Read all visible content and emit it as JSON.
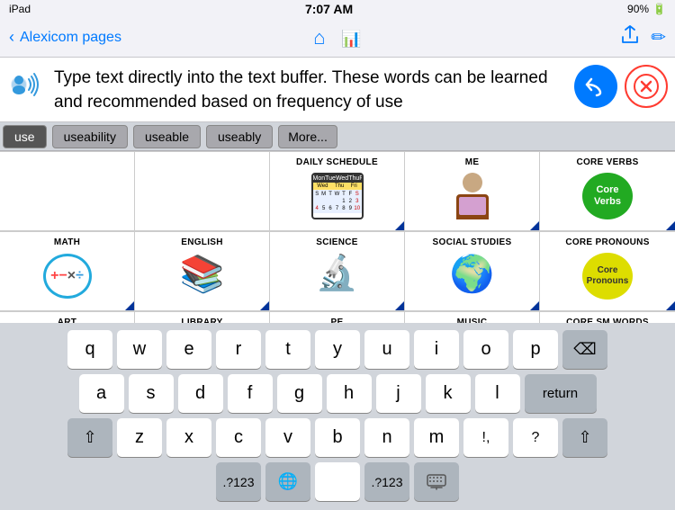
{
  "status": {
    "device": "iPad",
    "time": "7:07 AM",
    "battery": "90%",
    "battery_icon": "🔋"
  },
  "nav": {
    "back_label": "Alexicom pages",
    "home_icon": "⌂",
    "center_icon": "📊",
    "share_icon": "⬆",
    "edit_icon": "✏"
  },
  "buffer": {
    "text": "Type text directly into the text buffer. These words can be learned and recommended based on frequency of use",
    "undo_label": "↩",
    "close_label": "✕"
  },
  "suggestions": {
    "items": [
      "use",
      "useability",
      "useable",
      "useably",
      "More..."
    ]
  },
  "grid": {
    "rows": [
      [
        {
          "label": "DAILY SCHEDULE",
          "type": "calendar"
        },
        {
          "label": "ME",
          "type": "person"
        },
        {
          "label": "CORE VERBS",
          "type": "core-verbs",
          "text": "Core\nVerbs"
        }
      ],
      [
        {
          "label": "MATH",
          "type": "math"
        },
        {
          "label": "ENGLISH",
          "type": "book"
        },
        {
          "label": "SCIENCE",
          "type": "science"
        },
        {
          "label": "SOCIAL STUDIES",
          "type": "globe"
        },
        {
          "label": "CORE PRONOUNS",
          "type": "core-pronouns",
          "text": "Core\nPronouns"
        }
      ],
      [
        {
          "label": "ART",
          "type": "empty"
        },
        {
          "label": "LIBRARY",
          "type": "empty"
        },
        {
          "label": "PE",
          "type": "empty"
        },
        {
          "label": "MUSIC",
          "type": "empty"
        },
        {
          "label": "CORE SM WORDS",
          "type": "empty"
        }
      ]
    ]
  },
  "keyboard": {
    "rows": [
      [
        "q",
        "w",
        "e",
        "r",
        "t",
        "y",
        "u",
        "i",
        "o",
        "p"
      ],
      [
        "a",
        "s",
        "d",
        "f",
        "g",
        "h",
        "j",
        "k",
        "l"
      ],
      [
        "z",
        "x",
        "c",
        "v",
        "b",
        "n",
        "m",
        "!,",
        "?"
      ]
    ],
    "shift_label": "⇧",
    "backspace_label": "⌫",
    "return_label": "return",
    "numeric_label": ".?123",
    "globe_label": "🌐",
    "space_label": "",
    "hide_label": "⌨"
  }
}
